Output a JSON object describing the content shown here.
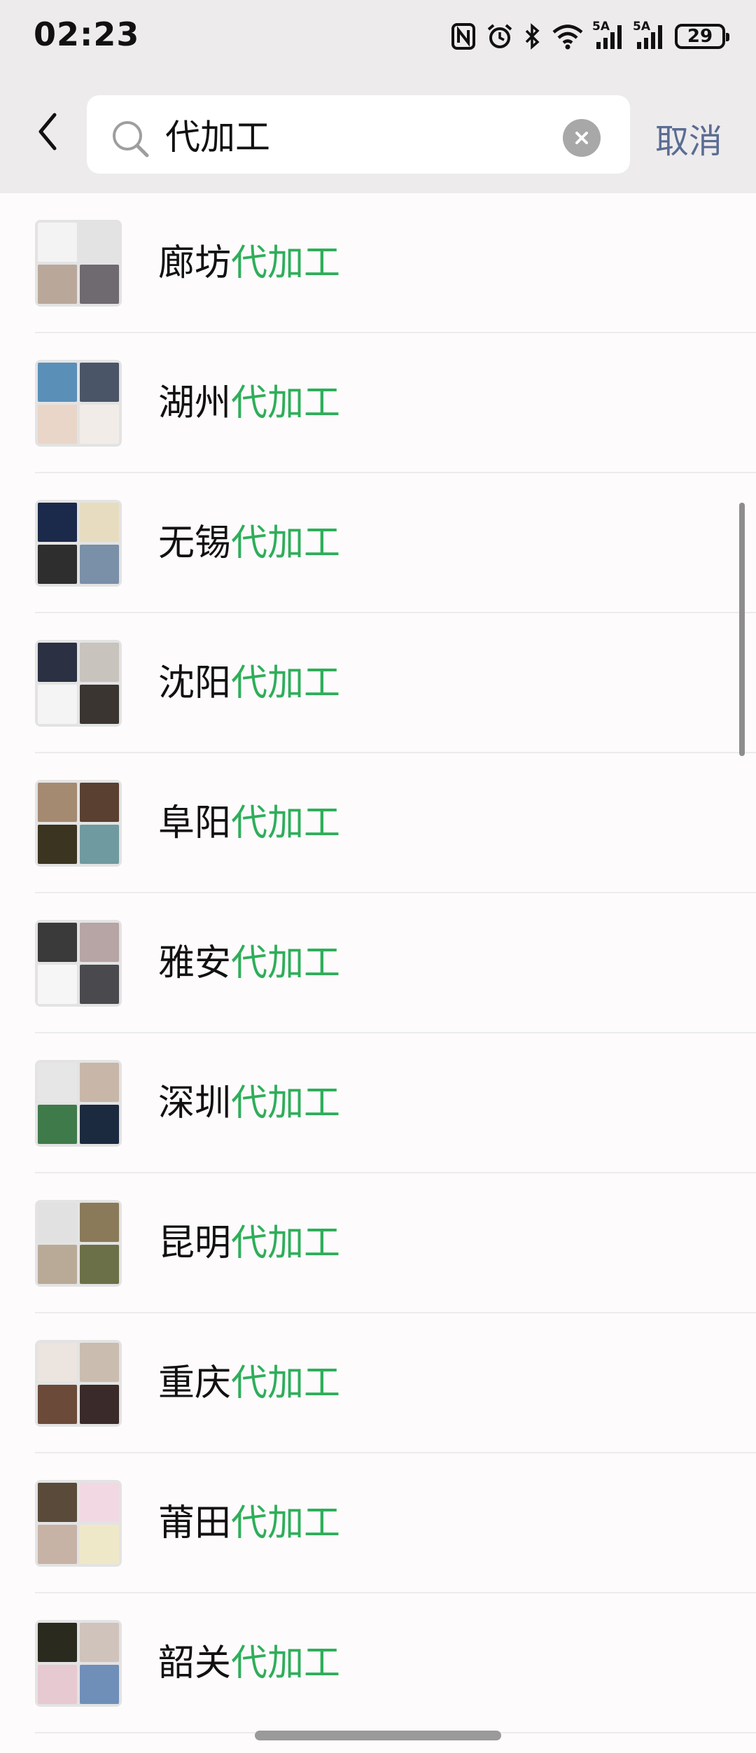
{
  "status_bar": {
    "time": "02:23",
    "signal_label_1": "5A",
    "signal_label_2": "5A",
    "battery": "29"
  },
  "search": {
    "value": "代加工",
    "cancel_label": "取消"
  },
  "colors": {
    "highlight": "#2fae5a",
    "cancel": "#5a6c93",
    "header_bg": "#edebec"
  },
  "results": [
    {
      "prefix": "廊坊",
      "match": "代加工"
    },
    {
      "prefix": "湖州",
      "match": "代加工"
    },
    {
      "prefix": "无锡",
      "match": "代加工"
    },
    {
      "prefix": "沈阳",
      "match": "代加工"
    },
    {
      "prefix": "阜阳",
      "match": "代加工"
    },
    {
      "prefix": "雅安",
      "match": "代加工"
    },
    {
      "prefix": "深圳",
      "match": "代加工"
    },
    {
      "prefix": "昆明",
      "match": "代加工"
    },
    {
      "prefix": "重庆",
      "match": "代加工"
    },
    {
      "prefix": "莆田",
      "match": "代加工"
    },
    {
      "prefix": "韶关",
      "match": "代加工"
    }
  ]
}
